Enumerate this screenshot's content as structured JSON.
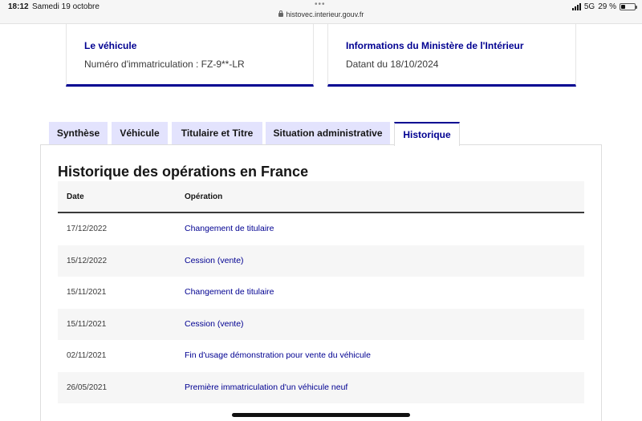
{
  "status_bar": {
    "time": "18:12",
    "date": "Samedi 19 octobre",
    "network": "5G",
    "battery": "29 %",
    "battery_level": 0.29
  },
  "browser": {
    "url": "histovec.interieur.gouv.fr"
  },
  "cards": {
    "vehicule": {
      "title": "Le véhicule",
      "text": "Numéro d'immatriculation : FZ-9**-LR"
    },
    "ministere": {
      "title": "Informations du Ministère de l'Intérieur",
      "text": "Datant du 18/10/2024"
    }
  },
  "tabs": [
    {
      "label": "Synthèse",
      "active": false
    },
    {
      "label": "Véhicule",
      "active": false
    },
    {
      "label": "Titulaire et Titre",
      "active": false
    },
    {
      "label": "Situation administrative",
      "active": false
    },
    {
      "label": "Historique",
      "active": true
    }
  ],
  "history": {
    "title": "Historique des opérations en France",
    "columns": {
      "date": "Date",
      "operation": "Opération"
    },
    "rows": [
      {
        "date": "17/12/2022",
        "operation": "Changement de titulaire"
      },
      {
        "date": "15/12/2022",
        "operation": "Cession (vente)"
      },
      {
        "date": "15/11/2021",
        "operation": "Changement de titulaire"
      },
      {
        "date": "15/11/2021",
        "operation": "Cession (vente)"
      },
      {
        "date": "02/11/2021",
        "operation": "Fin d'usage démonstration pour vente du véhicule"
      },
      {
        "date": "26/05/2021",
        "operation": "Première immatriculation d'un véhicule neuf"
      }
    ]
  },
  "colors": {
    "accent": "#000091",
    "tab_bg": "#e3e3fd",
    "row_alt": "#f6f6f6"
  }
}
